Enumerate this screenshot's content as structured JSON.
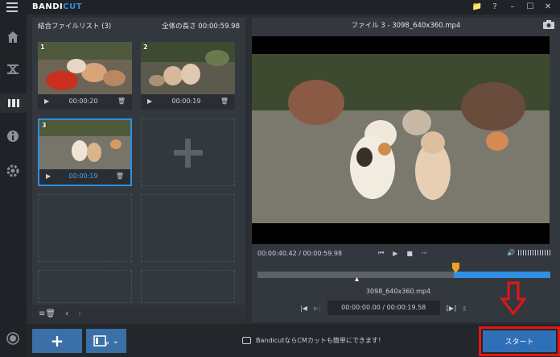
{
  "app": {
    "logo_main": "BANDI",
    "logo_accent": "CUT",
    "window_buttons": [
      "📁",
      "?",
      "–",
      "☐",
      "✕"
    ]
  },
  "left_panel": {
    "title": "結合ファイルリスト (3)",
    "total_length_label": "全体の長さ 00:00:59.98",
    "clips": [
      {
        "num": "1",
        "duration": "00:00:20",
        "selected": false
      },
      {
        "num": "2",
        "duration": "00:00:19",
        "selected": false
      },
      {
        "num": "3",
        "duration": "00:00:19",
        "selected": true
      }
    ]
  },
  "right_panel": {
    "file_title": "ファイル 3 - 3098_640x360.mp4",
    "current_time": "00:00:40.42 / 00:00:59.98",
    "timeline_filename": "3098_640x360.mp4",
    "range": "00:00:00.00 / 00:00:19.58",
    "timeline_progress": 0.67
  },
  "bottom_bar": {
    "add_label": "+",
    "promo_text": "BandicutならCMカットも簡単にできます！",
    "start_label": "スタート"
  },
  "colors": {
    "accent": "#2f8fe5",
    "highlight_red": "#e51515",
    "button_blue": "#3a6fa8"
  }
}
